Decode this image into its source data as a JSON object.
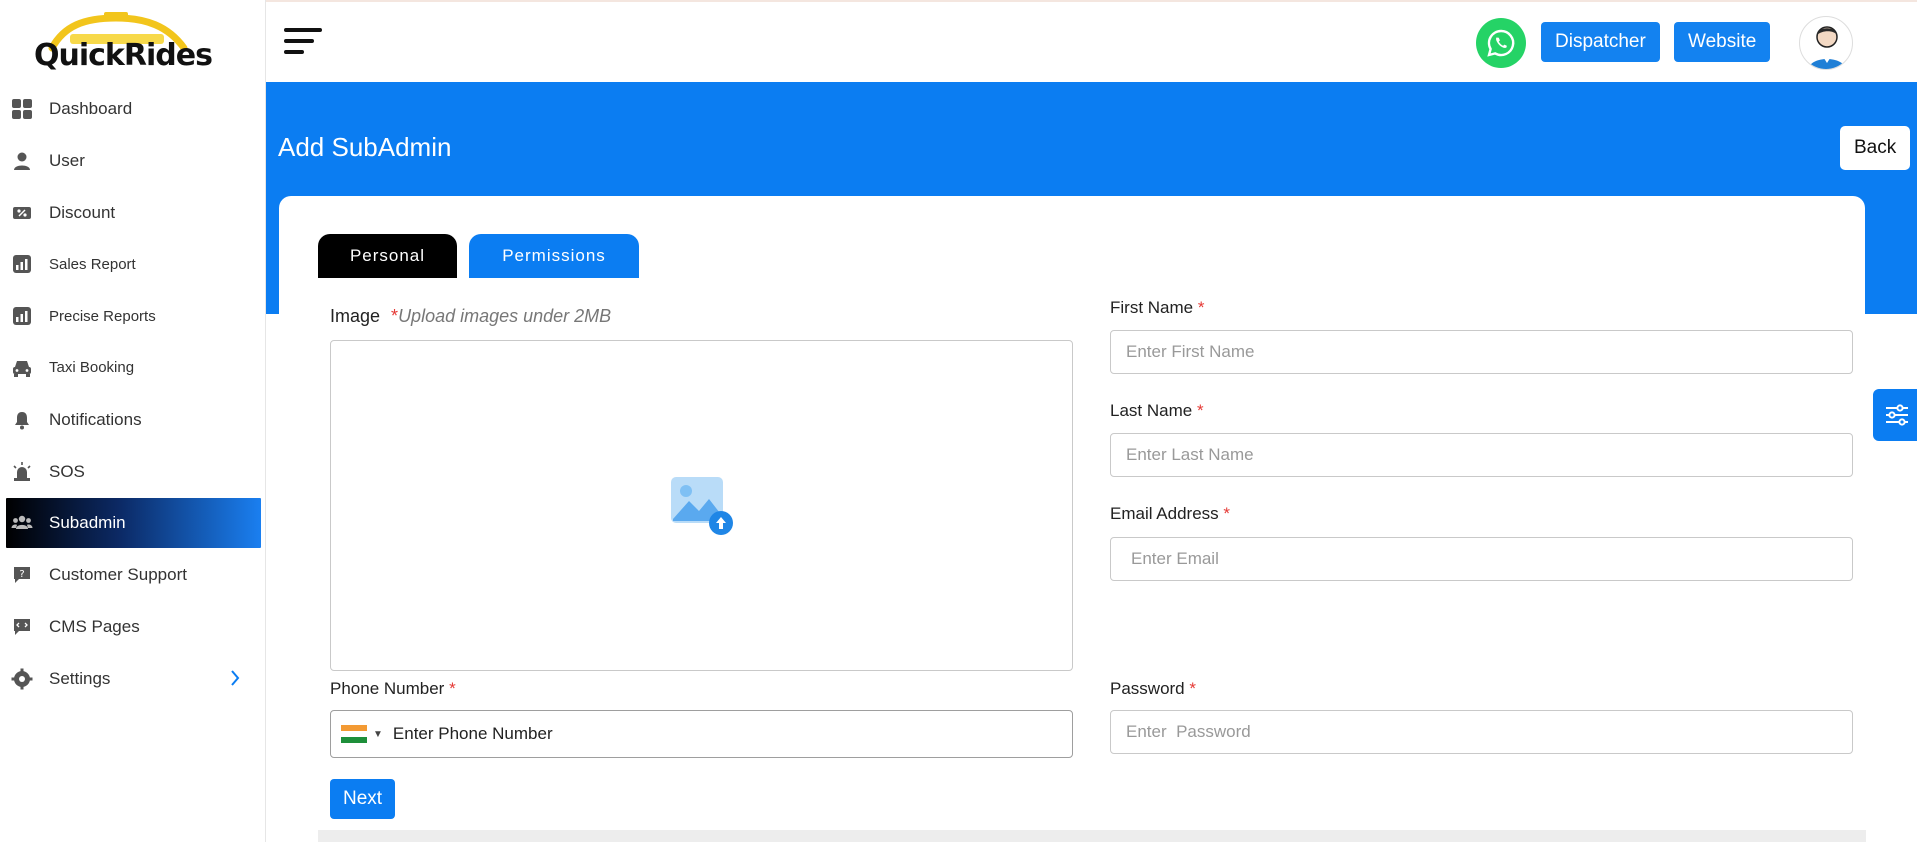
{
  "brand": {
    "name": "QuickRides",
    "accent": "#0b7df2",
    "active_gradient": [
      "#000000",
      "#1a7ff0"
    ]
  },
  "sidebar": {
    "items": [
      {
        "label": "Dashboard",
        "icon": "dashboard-icon"
      },
      {
        "label": "User",
        "icon": "user-icon"
      },
      {
        "label": "Discount",
        "icon": "discount-icon"
      },
      {
        "label": "Sales Report",
        "icon": "chart-icon"
      },
      {
        "label": "Precise Reports",
        "icon": "chart-icon"
      },
      {
        "label": "Taxi Booking",
        "icon": "car-icon"
      },
      {
        "label": "Notifications",
        "icon": "bell-icon"
      },
      {
        "label": "SOS",
        "icon": "alarm-icon"
      },
      {
        "label": "Subadmin",
        "icon": "users-icon",
        "active": true
      },
      {
        "label": "Customer Support",
        "icon": "support-icon"
      },
      {
        "label": "CMS Pages",
        "icon": "code-icon"
      },
      {
        "label": "Settings",
        "icon": "gear-icon"
      }
    ]
  },
  "topbar": {
    "dispatcher_label": "Dispatcher",
    "website_label": "Website"
  },
  "header": {
    "title": "Add SubAdmin",
    "back_label": "Back"
  },
  "tabs": [
    {
      "label": "Personal",
      "active": true
    },
    {
      "label": "Permissions",
      "active": false
    }
  ],
  "form": {
    "image": {
      "label": "Image",
      "hint": "Upload images under 2MB"
    },
    "first_name": {
      "label": "First Name",
      "placeholder": "Enter First Name"
    },
    "last_name": {
      "label": "Last Name",
      "placeholder": "Enter Last Name"
    },
    "email": {
      "label": "Email Address",
      "placeholder": "Enter Email"
    },
    "phone": {
      "label": "Phone Number",
      "placeholder": "Enter Phone Number"
    },
    "password": {
      "label": "Password",
      "placeholder": "Enter  Password"
    },
    "required_mark": "*",
    "next_label": "Next"
  }
}
